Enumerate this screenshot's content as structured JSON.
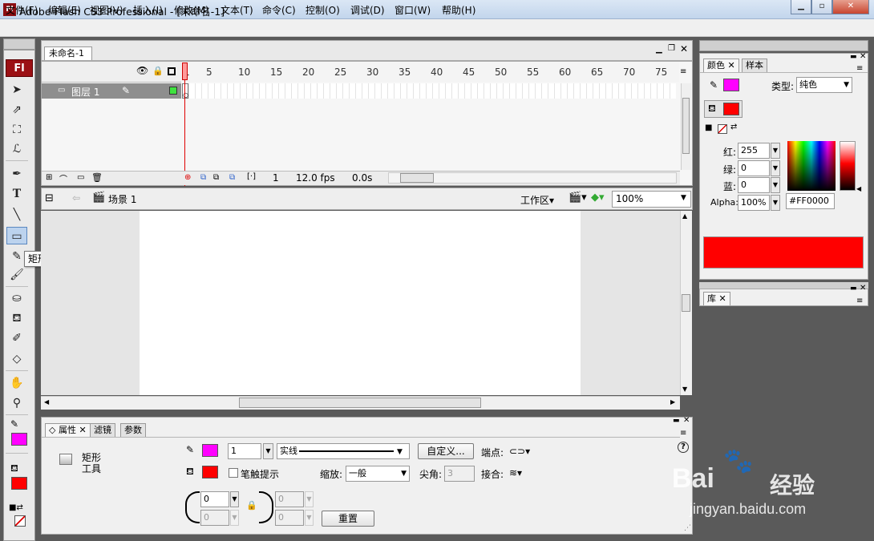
{
  "window": {
    "title": "Adobe Flash CS3 Professional - [未命名-1]",
    "app_icon_text": "Fl",
    "controls": [
      "minimize-icon",
      "maximize-icon",
      "close-icon"
    ]
  },
  "menu": [
    "文件(F)",
    "编辑(E)",
    "视图(V)",
    "插入(I)",
    "修改(M)",
    "文本(T)",
    "命令(C)",
    "控制(O)",
    "调试(D)",
    "窗口(W)",
    "帮助(H)"
  ],
  "document_tab": "未命名-1",
  "timeline": {
    "frame_numbers": [
      "1",
      "5",
      "10",
      "15",
      "20",
      "25",
      "30",
      "35",
      "40",
      "45",
      "50",
      "55",
      "60",
      "65",
      "70",
      "75"
    ],
    "layer_name": "图层 1",
    "current_frame": "1",
    "fps": "12.0 fps",
    "time": "0.0s"
  },
  "scene": {
    "name": "场景 1",
    "workspace_label": "工作区",
    "zoom": "100%"
  },
  "tools": {
    "tooltip": "矩形工具 (R,O,R,O)",
    "logo": "Fl",
    "stroke_color": "#ff00ff",
    "fill_color": "#ff0000"
  },
  "properties": {
    "tabs": [
      "属性",
      "滤镜",
      "参数"
    ],
    "tool_name": "矩形\n工具",
    "stroke_color": "#ff00ff",
    "fill_color": "#ff0000",
    "stroke_height": "1",
    "stroke_style": "实线",
    "custom_button": "自定义...",
    "cap_label": "端点:",
    "hinting_label": "笔触提示",
    "scale_label": "缩放:",
    "scale_value": "一般",
    "miter_label": "尖角:",
    "miter_value": "3",
    "join_label": "接合:",
    "corner_top_left": "0",
    "corner_bottom_left": "0",
    "corner_top_right": "0",
    "corner_bottom_right": "0",
    "reset_button": "重置",
    "help_icon": "?"
  },
  "color_panel": {
    "tabs": [
      "颜色",
      "样本"
    ],
    "type_label": "类型:",
    "type_value": "纯色",
    "red_label": "红:",
    "red_value": "255",
    "green_label": "绿:",
    "green_value": "0",
    "blue_label": "蓝:",
    "blue_value": "0",
    "alpha_label": "Alpha:",
    "alpha_value": "100%",
    "hex_value": "#FF0000",
    "stroke_color": "#ff00ff",
    "fill_color": "#ff0000"
  },
  "library_panel": {
    "tab": "库"
  },
  "watermark": {
    "brand": "Bai",
    "brand_suffix": "经验",
    "url": "jingyan.baidu.com"
  }
}
